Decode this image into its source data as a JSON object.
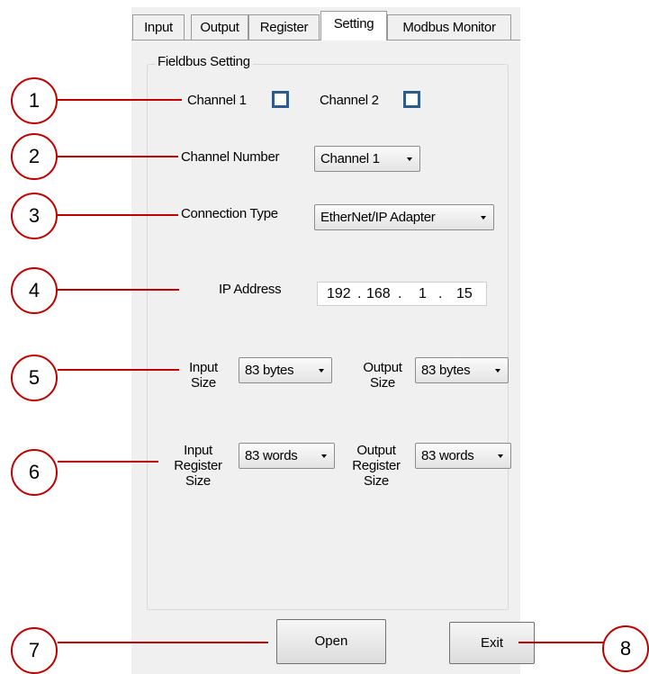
{
  "tabs": [
    {
      "label": "Input"
    },
    {
      "label": "Output"
    },
    {
      "label": "Register"
    },
    {
      "label": "Setting",
      "active": true
    },
    {
      "label": "Modbus Monitor"
    }
  ],
  "fieldbus": {
    "group_title": "Fieldbus Setting",
    "channel1_label": "Channel 1",
    "channel1_checked": false,
    "channel2_label": "Channel 2",
    "channel2_checked": false,
    "channel_number_label": "Channel Number",
    "channel_number_value": "Channel 1",
    "connection_type_label": "Connection Type",
    "connection_type_value": "EtherNet/IP Adapter",
    "ip_label": "IP Address",
    "ip_octets": [
      "192",
      "168",
      "1",
      "15"
    ],
    "ip_separator": ".",
    "input_size_label": [
      "Input",
      "Size"
    ],
    "input_size_value": "83 bytes",
    "output_size_label": [
      "Output",
      "Size"
    ],
    "output_size_value": "83 bytes",
    "input_register_size_label": [
      "Input",
      "Register",
      "Size"
    ],
    "input_register_size_value": "83 words",
    "output_register_size_label": [
      "Output",
      "Register",
      "Size"
    ],
    "output_register_size_value": "83 words"
  },
  "buttons": {
    "open_label": "Open",
    "exit_label": "Exit"
  },
  "callouts": [
    "1",
    "2",
    "3",
    "4",
    "5",
    "6",
    "7",
    "8"
  ],
  "colors": {
    "callout_red": "#c00000",
    "checkbox_blue": "#2e5b8c",
    "panel_bg": "#f0f0f0"
  }
}
